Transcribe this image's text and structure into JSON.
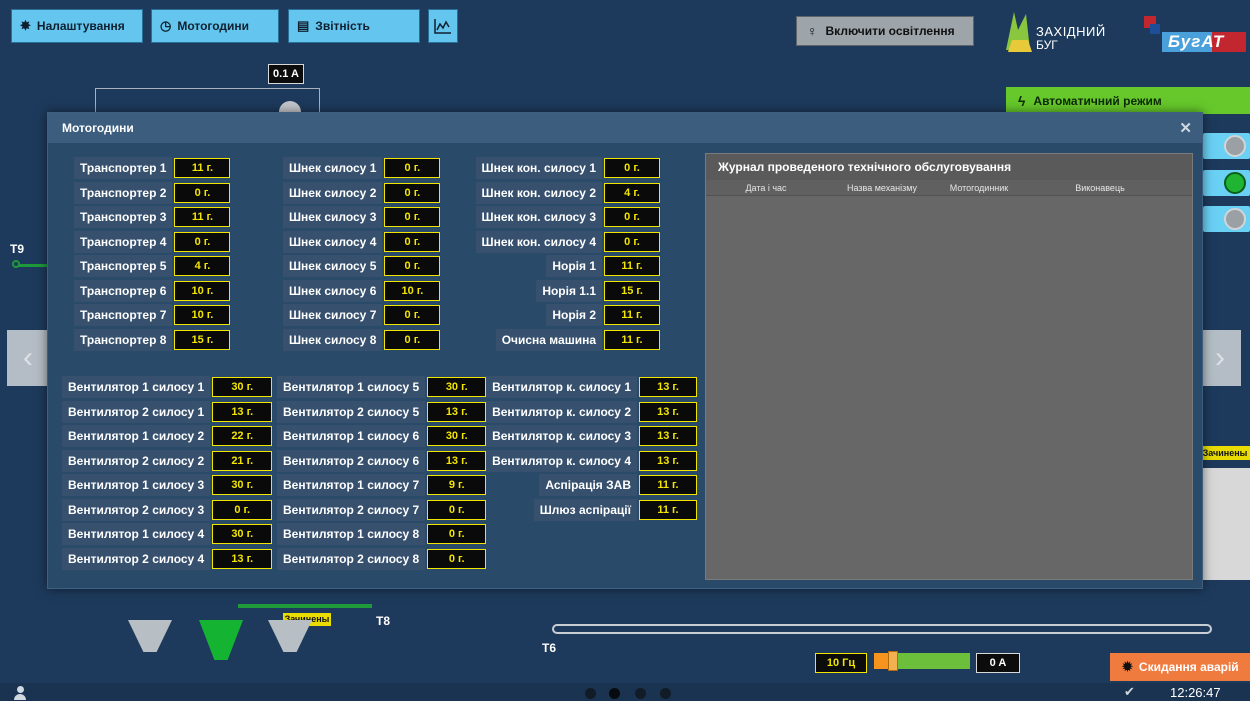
{
  "toolbar": {
    "settings": "Налаштування",
    "motor_hours": "Мотогодини",
    "reports": "Звітність",
    "lighting": "Включити освітлення"
  },
  "logos": {
    "zakhidny_line1": "ЗАХІДНИЙ",
    "zakhidny_line2": "БУГ",
    "bugat": "БугАТ"
  },
  "mode": {
    "label": "Автоматичний режим"
  },
  "background": {
    "current_top": "0.1 A",
    "t9": "T9",
    "t8": "T8",
    "t6": "T6",
    "clogged_left": "Зачинены",
    "clogged_right": "Зачинены",
    "freq": "10 Гц",
    "current_bottom": "0 A",
    "freq_level_pct": 15
  },
  "modal": {
    "title": "Мотогодини",
    "col1": [
      {
        "label": "Транспортер 1",
        "value": "11 г."
      },
      {
        "label": "Транспортер 2",
        "value": "0 г."
      },
      {
        "label": "Транспортер 3",
        "value": "11 г."
      },
      {
        "label": "Транспортер 4",
        "value": "0 г."
      },
      {
        "label": "Транспортер 5",
        "value": "4 г."
      },
      {
        "label": "Транспортер 6",
        "value": "10 г."
      },
      {
        "label": "Транспортер 7",
        "value": "10 г."
      },
      {
        "label": "Транспортер 8",
        "value": "15 г."
      }
    ],
    "col2": [
      {
        "label": "Шнек силосу 1",
        "value": "0 г."
      },
      {
        "label": "Шнек силосу 2",
        "value": "0 г."
      },
      {
        "label": "Шнек силосу 3",
        "value": "0 г."
      },
      {
        "label": "Шнек силосу 4",
        "value": "0 г."
      },
      {
        "label": "Шнек силосу 5",
        "value": "0 г."
      },
      {
        "label": "Шнек силосу 6",
        "value": "10 г."
      },
      {
        "label": "Шнек силосу 7",
        "value": "0 г."
      },
      {
        "label": "Шнек силосу 8",
        "value": "0 г."
      }
    ],
    "col3": [
      {
        "label": "Шнек кон. силосу 1",
        "value": "0 г."
      },
      {
        "label": "Шнек кон. силосу 2",
        "value": "4 г."
      },
      {
        "label": "Шнек кон. силосу 3",
        "value": "0 г."
      },
      {
        "label": "Шнек кон. силосу 4",
        "value": "0 г."
      },
      {
        "label": "Норія 1",
        "value": "11 г."
      },
      {
        "label": "Норія 1.1",
        "value": "15 г."
      },
      {
        "label": "Норія 2",
        "value": "11 г."
      },
      {
        "label": "Очисна машина",
        "value": "11 г."
      }
    ],
    "fan1": [
      {
        "label": "Вентилятор 1 силосу 1",
        "value": "30 г."
      },
      {
        "label": "Вентилятор 2 силосу 1",
        "value": "13 г."
      },
      {
        "label": "Вентилятор 1 силосу 2",
        "value": "22 г."
      },
      {
        "label": "Вентилятор 2 силосу 2",
        "value": "21 г."
      },
      {
        "label": "Вентилятор 1 силосу 3",
        "value": "30 г."
      },
      {
        "label": "Вентилятор 2 силосу 3",
        "value": "0 г."
      },
      {
        "label": "Вентилятор 1 силосу 4",
        "value": "30 г."
      },
      {
        "label": "Вентилятор 2 силосу 4",
        "value": "13 г."
      }
    ],
    "fan2": [
      {
        "label": "Вентилятор 1 силосу 5",
        "value": "30 г."
      },
      {
        "label": "Вентилятор 2 силосу 5",
        "value": "13 г."
      },
      {
        "label": "Вентилятор 1 силосу 6",
        "value": "30 г."
      },
      {
        "label": "Вентилятор 2 силосу 6",
        "value": "13 г."
      },
      {
        "label": "Вентилятор 1 силосу 7",
        "value": "9 г."
      },
      {
        "label": "Вентилятор 2 силосу 7",
        "value": "0 г."
      },
      {
        "label": "Вентилятор 1 силосу 8",
        "value": "0 г."
      },
      {
        "label": "Вентилятор 2 силосу 8",
        "value": "0 г."
      }
    ],
    "fan3": [
      {
        "label": "Вентилятор к. силосу 1",
        "value": "13 г."
      },
      {
        "label": "Вентилятор к. силосу 2",
        "value": "13 г."
      },
      {
        "label": "Вентилятор к. силосу 3",
        "value": "13 г."
      },
      {
        "label": "Вентилятор к. силосу 4",
        "value": "13 г."
      },
      {
        "label": "Аспірація ЗАВ",
        "value": "11 г."
      },
      {
        "label": "Шлюз аспірації",
        "value": "11 г."
      }
    ],
    "journal": {
      "title": "Журнал проведеного технічного обслуговування",
      "columns": [
        "Дата і час",
        "Назва механізму",
        "Мотогодинник",
        "Виконавець"
      ]
    }
  },
  "footer": {
    "reset": "Скидання аварій",
    "time": "12:26:47"
  },
  "colors": {
    "accent_blue": "#64c6ee",
    "auto_green": "#66c82a",
    "reset_orange": "#f07b3e",
    "value_yellow": "#f2e500"
  }
}
